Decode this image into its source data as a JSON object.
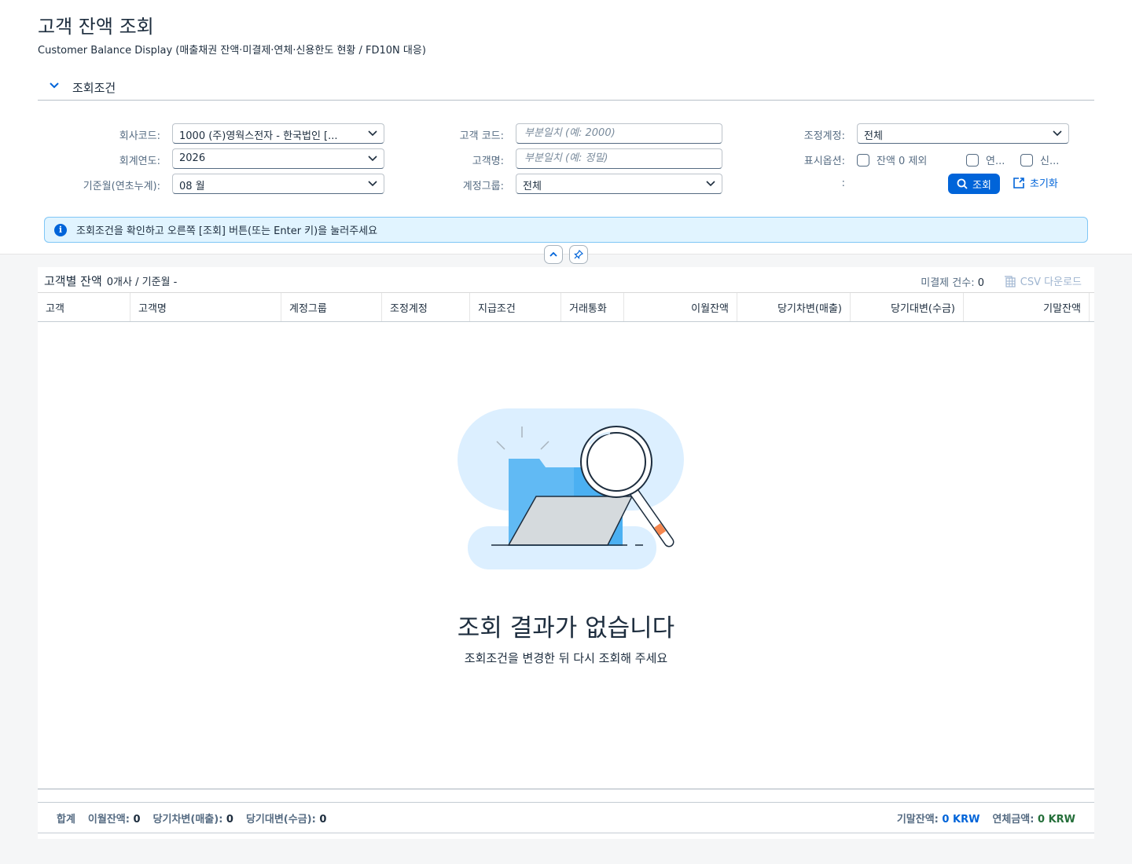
{
  "header": {
    "title": "고객 잔액 조회",
    "subtitle": "Customer Balance Display (매출채권 잔액·미결제·연체·신용한도 현황 / FD10N 대응)"
  },
  "filter": {
    "section_title": "조회조건",
    "company_code_label": "회사코드:",
    "company_code_value": "1000 (주)영웍스전자 - 한국법인 [...",
    "fiscal_year_label": "회계연도:",
    "fiscal_year_value": "2026",
    "period_label": "기준월(연초누계):",
    "period_value": "08 월",
    "customer_code_label": "고객 코드:",
    "customer_code_placeholder": "부분일치 (예: 2000)",
    "customer_name_label": "고객명:",
    "customer_name_placeholder": "부분일치 (예: 정밀)",
    "account_group_label": "계정그룹:",
    "account_group_value": "전체",
    "recon_account_label": "조정계정:",
    "recon_account_value": "전체",
    "display_options_label": "표시옵션:",
    "option_zero_balance": "잔액 0 제외",
    "option_overdue": "연...",
    "option_credit": "신...",
    "colon_label": ":",
    "search_button": "조회",
    "reset_button": "초기화"
  },
  "info_message": "조회조건을 확인하고 오른쪽 [조회] 버튼(또는 Enter 키)을 눌러주세요",
  "table": {
    "title": "고객별 잔액",
    "summary": "0개사 / 기준월 -",
    "open_count_label": "미결제 건수:",
    "open_count_value": "0",
    "csv_button": "CSV 다운로드",
    "columns": [
      "고객",
      "고객명",
      "계정그룹",
      "조정계정",
      "지급조건",
      "거래통화",
      "이월잔액",
      "당기차변(매출)",
      "당기대변(수금)",
      "기말잔액"
    ],
    "empty_title": "조회 결과가 없습니다",
    "empty_desc": "조회조건을 변경한 뒤 다시 조회해 주세요"
  },
  "footer": {
    "total_label": "합계",
    "carry_label": "이월잔액:",
    "carry_value": "0",
    "debit_label": "당기차변(매출):",
    "debit_value": "0",
    "credit_label": "당기대변(수금):",
    "credit_value": "0",
    "ending_label": "기말잔액:",
    "ending_value": "0 KRW",
    "overdue_label": "연체금액:",
    "overdue_value": "0 KRW"
  },
  "colors": {
    "accent": "#0064d9",
    "info_bg": "#e1f4ff",
    "positive": "#256f3a"
  }
}
